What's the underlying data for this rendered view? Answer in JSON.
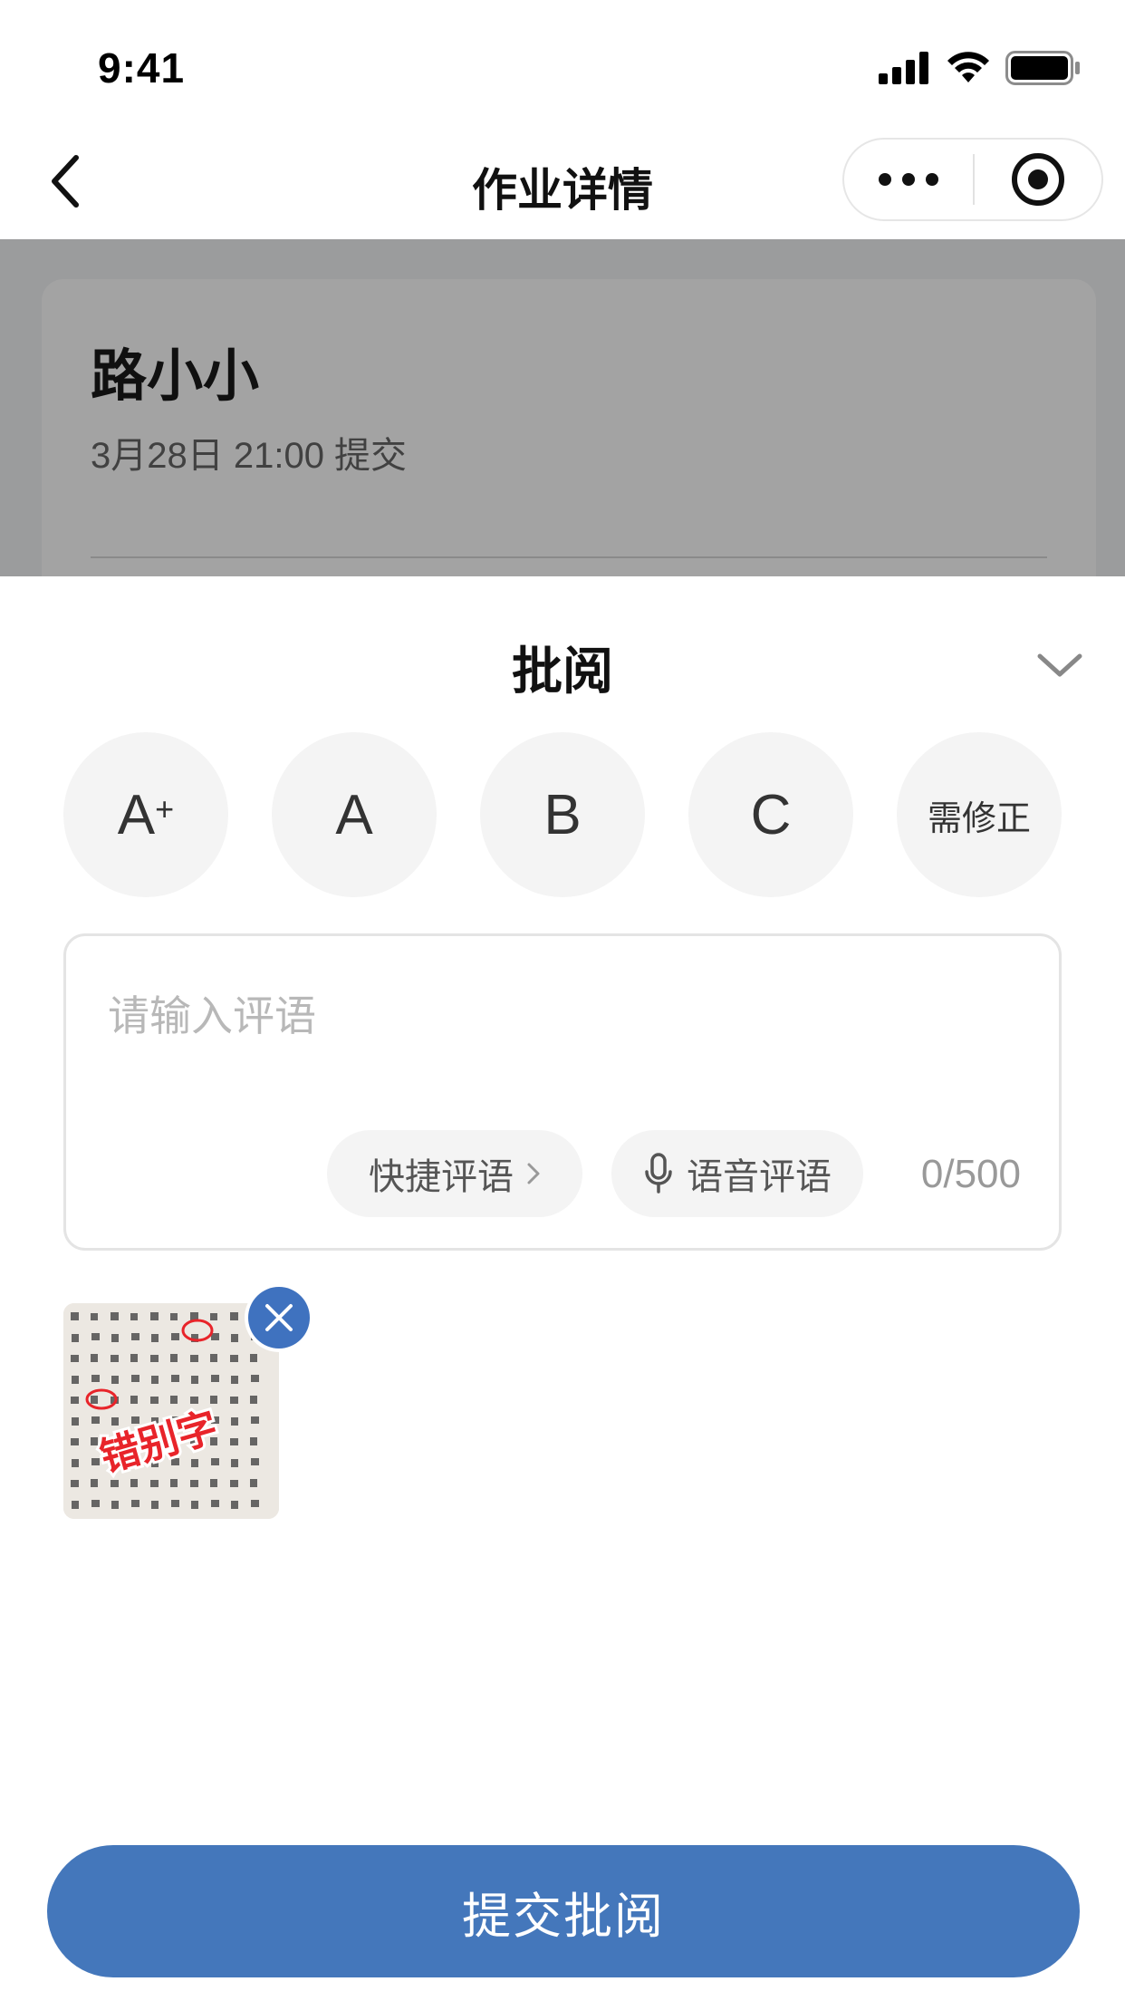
{
  "status_bar": {
    "time": "9:41"
  },
  "nav": {
    "title": "作业详情"
  },
  "background": {
    "student_name": "路小小",
    "submit_time": "3月28日 21:00 提交"
  },
  "sheet": {
    "title": "批阅",
    "grades": [
      "A",
      "A",
      "B",
      "C",
      "需修正"
    ],
    "grade_superscript": "+",
    "comment_placeholder": "请输入评语",
    "quick_comment_label": "快捷评语",
    "voice_comment_label": "语音评语",
    "char_counter": "0/500",
    "attachment_stamp": "错别字",
    "submit_label": "提交批阅"
  },
  "colors": {
    "primary": "#4477bb",
    "remove_badge": "#3f72bf",
    "grade_bg": "#f4f4f4",
    "stamp_red": "#e8242a"
  }
}
